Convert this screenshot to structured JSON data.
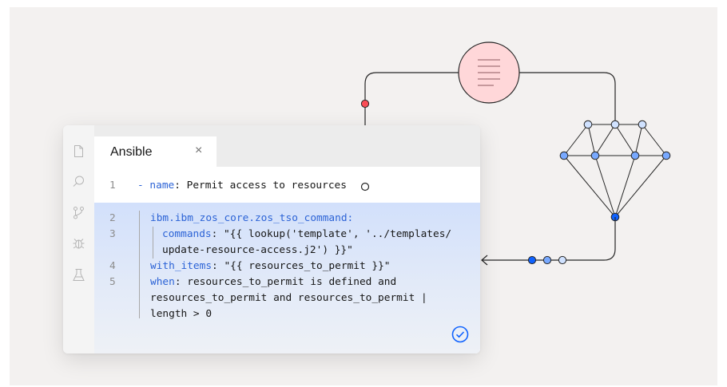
{
  "tab": {
    "label": "Ansible",
    "close": "×"
  },
  "lines": [
    {
      "num": "1",
      "key": "- name",
      "text": ": Permit access to resources"
    },
    {
      "num": "2",
      "key": "ibm.ibm_zos_core.zos_tso_command:",
      "text": ""
    },
    {
      "num": "3",
      "key": "commands",
      "text": ": \"{{ lookup('template', '../templates/"
    },
    {
      "num": "",
      "key": "",
      "text": "update-resource-access.j2') }}\""
    },
    {
      "num": "4",
      "key": "with_items",
      "text": ": \"{{ resources_to_permit }}\""
    },
    {
      "num": "5",
      "key": "when",
      "text": ": resources_to_permit is defined and"
    },
    {
      "num": "",
      "key": "",
      "text": "resources_to_permit and resources_to_permit |"
    },
    {
      "num": "",
      "key": "",
      "text": "length > 0"
    }
  ],
  "colors": {
    "keyword": "#2c63d6",
    "highlight": "#d2e0fb",
    "node_dark": "#0f62fe",
    "node_mid": "#78a9ff",
    "node_light": "#d0e2ff",
    "doc_circle": "#ffd7d9",
    "red_dot": "#fa4d56"
  },
  "icons": [
    "file-icon",
    "search-icon",
    "branch-icon",
    "bug-icon",
    "flask-icon",
    "close-icon",
    "check-circle-icon",
    "document-icon",
    "arrow-left-icon"
  ]
}
